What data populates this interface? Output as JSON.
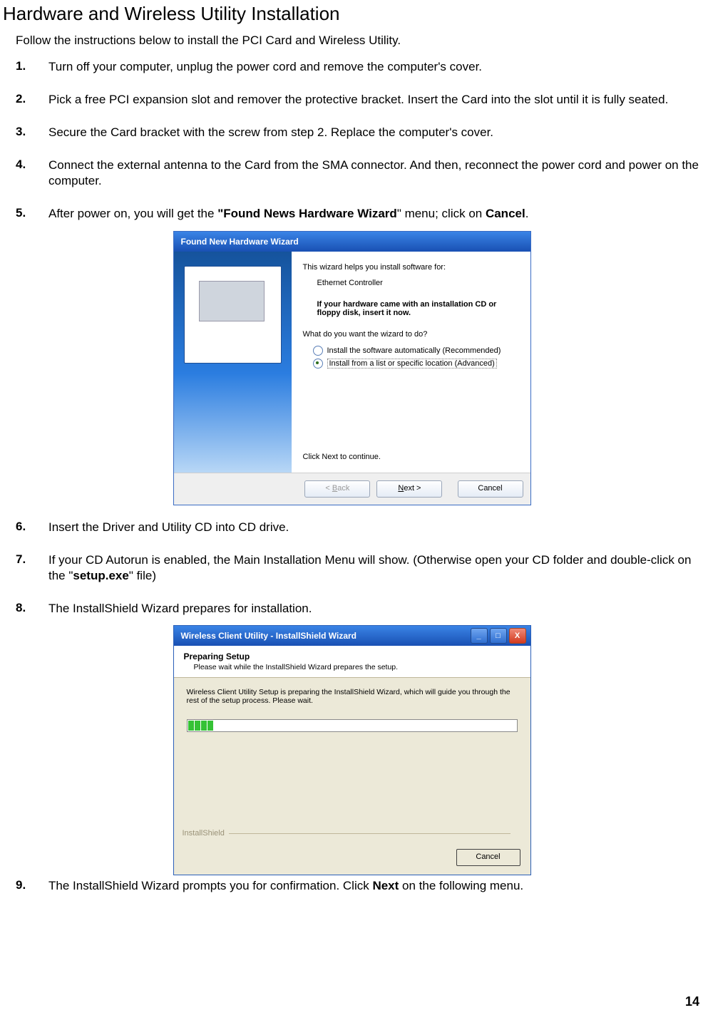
{
  "title": "Hardware and Wireless Utility Installation",
  "intro": "Follow the instructions below to install the PCI Card and Wireless Utility.",
  "steps": {
    "s1_num": "1.",
    "s1": "Turn off your computer, unplug the power cord and remove the computer's cover.",
    "s2_num": "2.",
    "s2": "Pick a free PCI expansion slot and remover the protective bracket. Insert the Card into the slot until it is fully seated.",
    "s3_num": "3.",
    "s3": "Secure the Card bracket with the screw from step 2. Replace the computer's cover.",
    "s4_num": "4.",
    "s4": "Connect the external antenna to the Card from the SMA connector. And then, reconnect the power cord and power on the computer.",
    "s5_num": "5.",
    "s5_pre": "After power on, you will get the ",
    "s5_bold": "\"Found News Hardware Wizard",
    "s5_mid": "\" menu; click on ",
    "s5_bold2": "Cancel",
    "s5_post": ".",
    "s6_num": "6.",
    "s6": "Insert the Driver and Utility CD into CD drive.",
    "s7_num": "7.",
    "s7_pre": "If your CD Autorun is enabled, the Main Installation Menu will show. (Otherwise open your CD folder and double-click on the \"",
    "s7_bold": "setup.exe",
    "s7_post": "\" file)",
    "s8_num": "8.",
    "s8": "The InstallShield Wizard prepares for installation.",
    "s9_num": "9.",
    "s9_pre": "The InstallShield Wizard prompts you for confirmation. Click ",
    "s9_bold": "Next",
    "s9_post": " on the following menu."
  },
  "fnhw": {
    "title": "Found New Hardware Wizard",
    "line1": "This wizard helps you install software for:",
    "device": "Ethernet Controller",
    "insert_cd": "If your hardware came with an installation CD or floppy disk, insert it now.",
    "question": "What do you want the wizard to do?",
    "opt1": "Install the software automatically (Recommended)",
    "opt2": "Install from a list or specific location (Advanced)",
    "click_next": "Click Next to continue.",
    "back_pre": "< ",
    "back_letter": "B",
    "back_post": "ack",
    "next_letter": "N",
    "next_post": "ext >",
    "cancel": "Cancel"
  },
  "isw": {
    "title": "Wireless Client Utility - InstallShield Wizard",
    "min": "_",
    "max": "□",
    "close": "X",
    "header1": "Preparing Setup",
    "header2": "Please wait while the InstallShield Wizard prepares the setup.",
    "body": "Wireless Client Utility Setup is preparing the InstallShield Wizard, which will guide you through the rest of the setup process. Please wait.",
    "brand": "InstallShield",
    "cancel": "Cancel"
  },
  "page_num": "14"
}
